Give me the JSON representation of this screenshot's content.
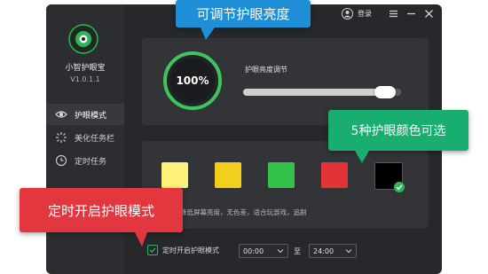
{
  "app": {
    "name": "小智护眼宝",
    "version": "V1.0.1.1"
  },
  "titlebar": {
    "login_label": "登录"
  },
  "sidebar": {
    "items": [
      {
        "label": "护眼模式",
        "icon": "eye-icon",
        "active": true
      },
      {
        "label": "美化任务栏",
        "icon": "sparkle-icon",
        "active": false
      },
      {
        "label": "定时任务",
        "icon": "clock-icon",
        "active": false
      }
    ]
  },
  "brightness": {
    "value_text": "100%",
    "value": 100,
    "label": "护眼亮度调节",
    "slider_fraction": 0.9
  },
  "colors": {
    "swatches": [
      "#fff27a",
      "#f3cf1d",
      "#35c24a",
      "#e23434",
      "#000000"
    ],
    "selected_index": 4,
    "description": "深度降低屏幕亮度，无色差，适合玩游戏，追剧"
  },
  "schedule": {
    "checkbox_label": "定时开启护眼模式",
    "checked": true,
    "start": "00:00",
    "to_label": "至",
    "end": "24:00"
  },
  "callouts": {
    "brightness": "可调节护眼亮度",
    "colors": "5种护眼颜色可选",
    "schedule": "定时开启护眼模式"
  },
  "accent": "#2fb35a"
}
